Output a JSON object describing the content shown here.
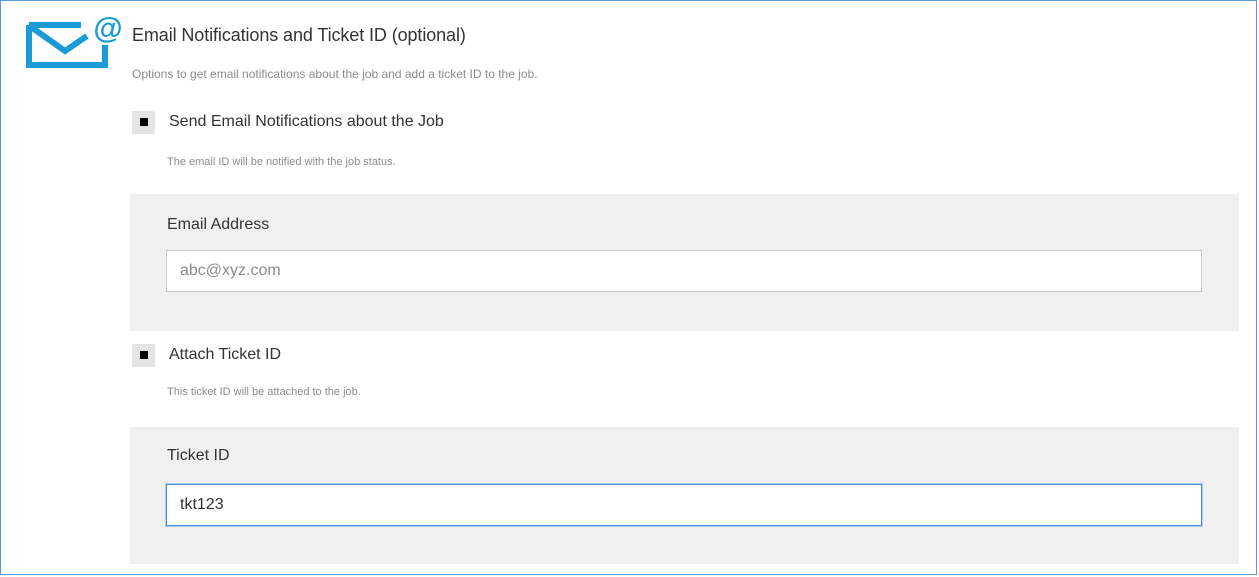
{
  "section": {
    "icon": "email-at-icon",
    "title": "Email Notifications and Ticket ID (optional)",
    "description": "Options to get email notifications about the job and add a ticket ID to the job."
  },
  "email_notifications": {
    "checked": true,
    "label": "Send Email Notifications about the Job",
    "hint": "The email ID will be notified with the job status.",
    "field_label": "Email Address",
    "placeholder": "abc@xyz.com",
    "value": ""
  },
  "ticket": {
    "checked": true,
    "label": "Attach Ticket ID",
    "hint": "This ticket ID will be attached to the job.",
    "field_label": "Ticket ID",
    "value": "tkt123"
  },
  "colors": {
    "icon_blue": "#1a9ad6",
    "frame_border": "#5b9bd5",
    "panel_bg": "#f0f0f0",
    "focus_border": "#4a90d9"
  }
}
